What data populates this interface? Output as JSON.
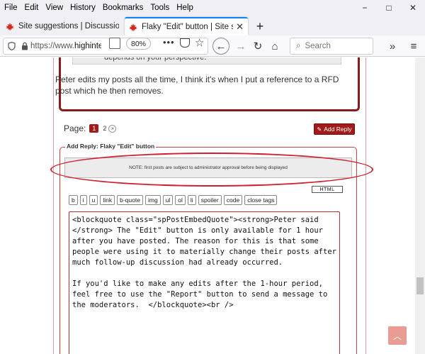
{
  "menubar": {
    "items": [
      "File",
      "Edit",
      "View",
      "History",
      "Bookmarks",
      "Tools",
      "Help"
    ],
    "window_controls": [
      "−",
      "□",
      "✕"
    ]
  },
  "tabs": [
    {
      "title": "Site suggestions | Discussion fo",
      "active": false
    },
    {
      "title": "Flaky \"Edit\" button | Site sugge",
      "active": true,
      "close": "✕"
    }
  ],
  "newtab_label": "+",
  "navbar": {
    "url_prefix": "https://www.",
    "url_host": "highinte",
    "zoom": "80%",
    "search_placeholder": "Search"
  },
  "post": {
    "quote_tail": "depends on your perspective.",
    "text": "Peter edits my posts all the time, I think it's when I put a reference to a RFD post which he then removes."
  },
  "pager": {
    "label": "Page:",
    "current": "1",
    "other": "2"
  },
  "add_reply_button": "Add Reply",
  "reply_form": {
    "legend": "Add Reply: Flaky \"Edit\" button",
    "notice": "NOTE: first posts are subject to administrator approval before being displayed",
    "html_button": "HTML",
    "toolbar": [
      "b",
      "i",
      "u",
      "link",
      "b-quote",
      "img",
      "ul",
      "ol",
      "li",
      "spoiler",
      "code",
      "close tags"
    ],
    "editor_content": "<blockquote class=\"spPostEmbedQuote\"><strong>Peter said </strong> The \"Edit\" button is only available for 1 hour after you have posted. The reason for this is that some people were using it to materially change their posts after much follow-up discussion had already occurred.\n\nIf you'd like to make any edits after the 1-hour period, feel free to use the \"Report\" button to send a message to the moderators.  </blockquote><br />"
  },
  "colors": {
    "brand": "#a11b1b",
    "annotation": "#d01f2f",
    "tab_accent": "#0a84ff"
  }
}
